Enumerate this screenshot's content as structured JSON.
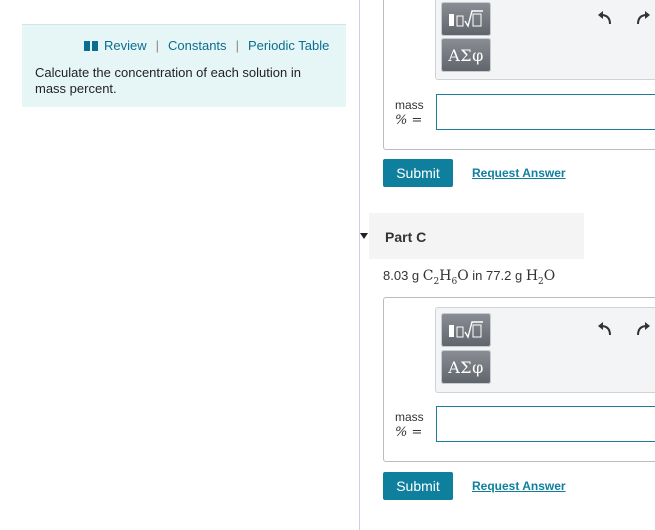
{
  "nav": {
    "review": "Review",
    "sep1": "|",
    "constants": "Constants",
    "sep2": "|",
    "periodic_table": "Periodic Table"
  },
  "instruction": "Calculate the concentration of each solution in mass percent.",
  "part_b": {
    "mass_label": "mass",
    "pct_label": "% =",
    "answer_value": "",
    "submit_label": "Submit",
    "request_answer_label": "Request Answer",
    "toolbar": {
      "greek_label": "ΑΣφ",
      "template_icon": "templates-icon",
      "undo_icon": "undo-icon",
      "redo_icon": "redo-icon"
    }
  },
  "part_c": {
    "title": "Part C",
    "problem": {
      "amount1": "8.03 g",
      "solute_c": "C",
      "solute_c_sub": "2",
      "solute_h": "H",
      "solute_h_sub": "6",
      "solute_o": "O",
      "word_in": "in",
      "amount2": "77.2 g",
      "solvent_h": "H",
      "solvent_h_sub": "2",
      "solvent_o": "O"
    },
    "mass_label": "mass",
    "pct_label": "% =",
    "answer_value": "",
    "submit_label": "Submit",
    "request_answer_label": "Request Answer",
    "toolbar": {
      "greek_label": "ΑΣφ",
      "template_icon": "templates-icon",
      "undo_icon": "undo-icon",
      "redo_icon": "redo-icon"
    }
  },
  "colors": {
    "accent": "#0f7f9e",
    "info_bg": "#e6f6f7",
    "link": "#0b6d8f",
    "toolbar_bg": "#f3f4f5"
  }
}
